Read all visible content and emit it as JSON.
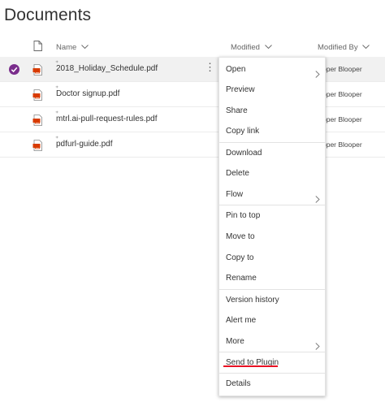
{
  "page": {
    "title": "Documents"
  },
  "columns": {
    "name": "Name",
    "modified": "Modified",
    "modified_by": "Modified By"
  },
  "files": [
    {
      "name": "2018_Holiday_Schedule.pdf",
      "modified_by": "oper Blooper",
      "selected": true
    },
    {
      "name": "Doctor signup.pdf",
      "modified_by": "oper Blooper",
      "selected": false
    },
    {
      "name": "mtrl.ai-pull-request-rules.pdf",
      "modified_by": "oper Blooper",
      "selected": false
    },
    {
      "name": "pdfurl-guide.pdf",
      "modified_by": "oper Blooper",
      "selected": false
    }
  ],
  "context_menu": {
    "open": "Open",
    "preview": "Preview",
    "share": "Share",
    "copy_link": "Copy link",
    "download": "Download",
    "delete": "Delete",
    "flow": "Flow",
    "pin_to_top": "Pin to top",
    "move_to": "Move to",
    "copy_to": "Copy to",
    "rename": "Rename",
    "version_history": "Version history",
    "alert_me": "Alert me",
    "more": "More",
    "send_to_plugin": "Send to Plugin",
    "details": "Details"
  },
  "colors": {
    "accent": "#7a2d8c",
    "pdf_red": "#d83b01",
    "highlight_underline": "#e81123"
  }
}
